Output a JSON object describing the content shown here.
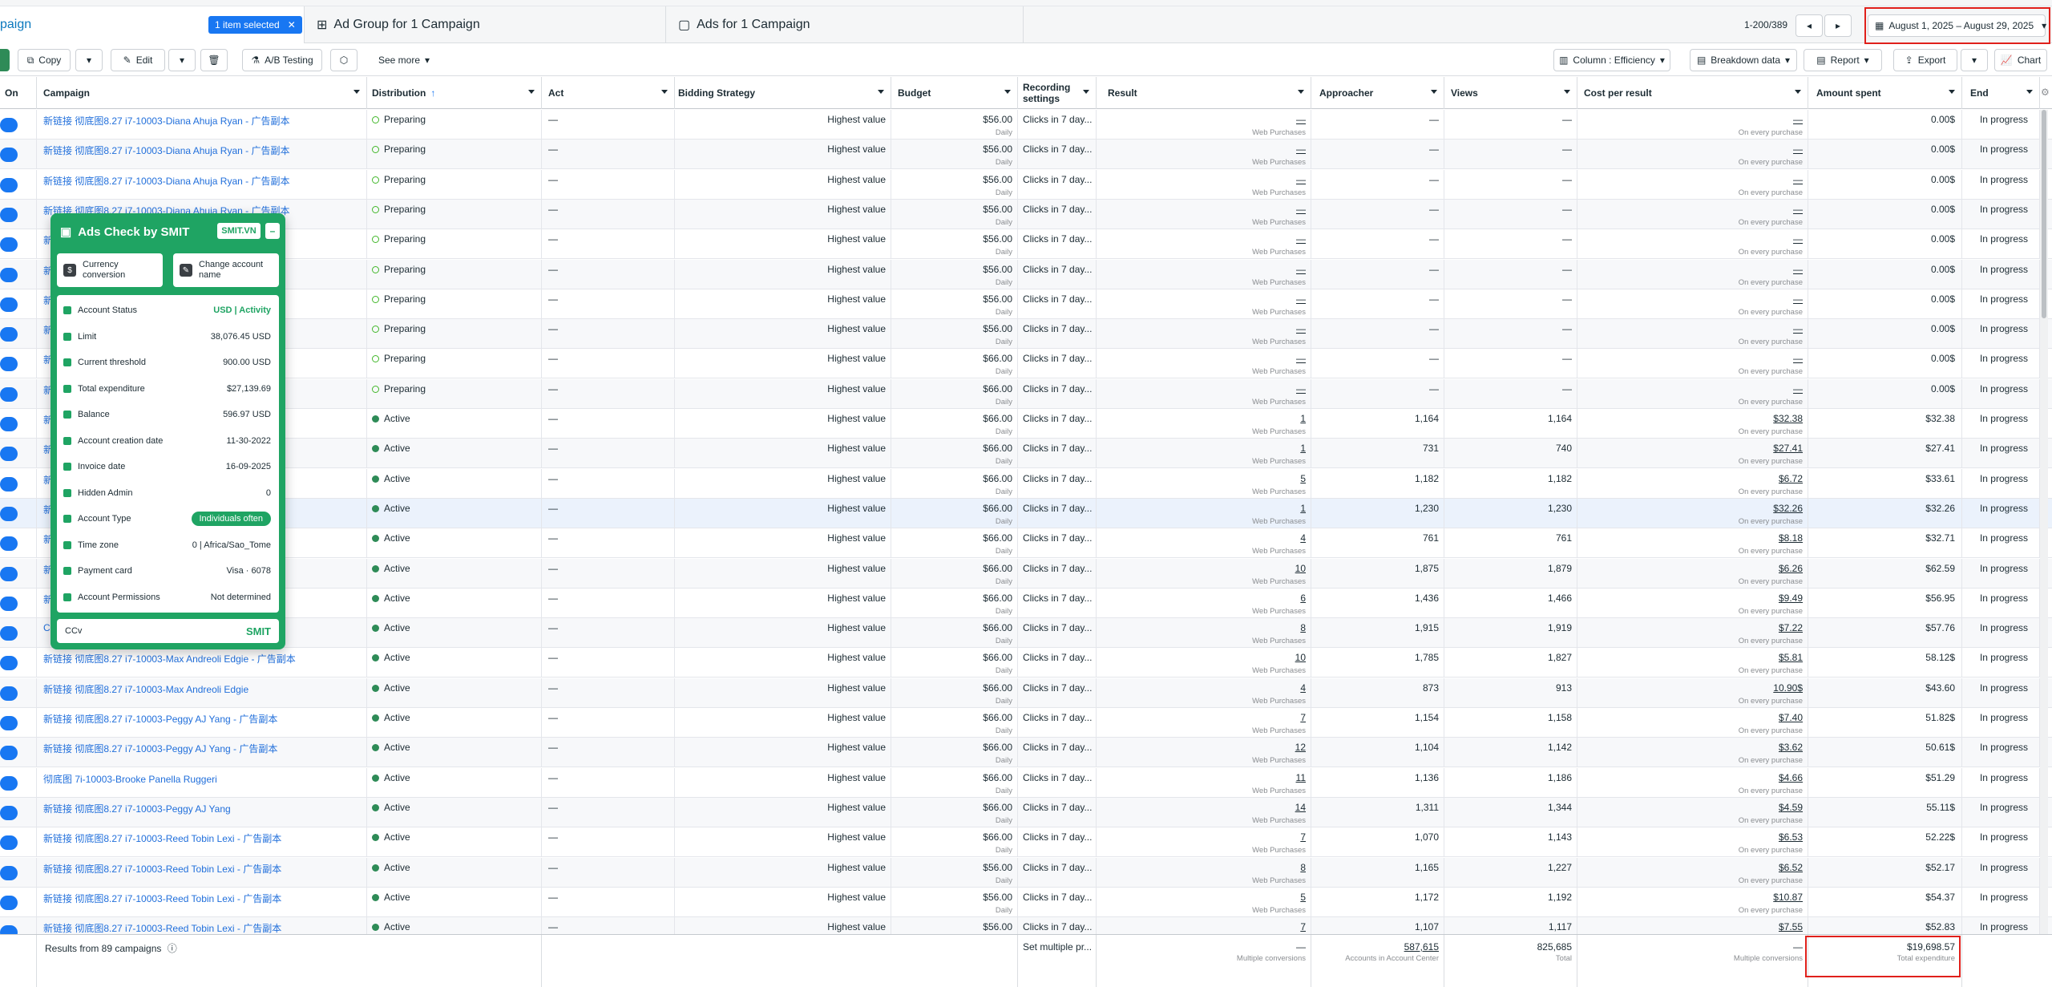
{
  "tabs": {
    "campaign_tab": "paign",
    "selected_badge": "1 item selected",
    "adgroup_tab": "Ad Group for 1 Campaign",
    "ads_tab": "Ads for 1 Campaign",
    "pagination": "1-200/389",
    "date_range": "August 1, 2025 – August 29, 2025"
  },
  "toolbar": {
    "copy": "Copy",
    "edit": "Edit",
    "ab_testing": "A/B Testing",
    "see_more": "See more",
    "column": "Column : Efficiency",
    "breakdown": "Breakdown data",
    "report": "Report",
    "export": "Export",
    "chart": "Chart"
  },
  "columns": {
    "on": "On",
    "campaign": "Campaign",
    "distribution": "Distribution",
    "act": "Act",
    "bidding": "Bidding Strategy",
    "budget": "Budget",
    "recording": "Recording settings",
    "result": "Result",
    "approacher": "Approacher",
    "views": "Views",
    "cost": "Cost per result",
    "amount": "Amount spent",
    "end": "End"
  },
  "rows": [
    {
      "campaign": "新链接 彻底图8.27 i7-10003-Diana Ahuja Ryan - 广告副本",
      "status": "Preparing",
      "active": false,
      "act": "—",
      "bidding": "Highest value",
      "budget": "$56.00",
      "budget_sub": "Daily",
      "recording": "Clicks in 7 day...",
      "result": "—",
      "result_sub": "Web Purchases",
      "approacher": "—",
      "views": "—",
      "cost": "—",
      "cost_sub": "On every purchase",
      "amount": "0.00$",
      "end": "In progress"
    },
    {
      "campaign": "新链接 彻底图8.27 i7-10003-Diana Ahuja Ryan - 广告副本",
      "status": "Preparing",
      "active": false,
      "act": "—",
      "bidding": "Highest value",
      "budget": "$56.00",
      "budget_sub": "Daily",
      "recording": "Clicks in 7 day...",
      "result": "—",
      "result_sub": "Web Purchases",
      "approacher": "—",
      "views": "—",
      "cost": "—",
      "cost_sub": "On every purchase",
      "amount": "0.00$",
      "end": "In progress"
    },
    {
      "campaign": "新链接 彻底图8.27 i7-10003-Diana Ahuja Ryan - 广告副本",
      "status": "Preparing",
      "active": false,
      "act": "—",
      "bidding": "Highest value",
      "budget": "$56.00",
      "budget_sub": "Daily",
      "recording": "Clicks in 7 day...",
      "result": "—",
      "result_sub": "Web Purchases",
      "approacher": "—",
      "views": "—",
      "cost": "—",
      "cost_sub": "On every purchase",
      "amount": "0.00$",
      "end": "In progress"
    },
    {
      "campaign": "新链接 彻底图8.27 i7-10003-Diana Ahuja Ryan - 广告副本",
      "status": "Preparing",
      "active": false,
      "act": "—",
      "bidding": "Highest value",
      "budget": "$56.00",
      "budget_sub": "Daily",
      "recording": "Clicks in 7 day...",
      "result": "—",
      "result_sub": "Web Purchases",
      "approacher": "—",
      "views": "—",
      "cost": "—",
      "cost_sub": "On every purchase",
      "amount": "0.00$",
      "end": "In progress"
    },
    {
      "campaign": "新链",
      "status": "Preparing",
      "active": false,
      "act": "—",
      "bidding": "Highest value",
      "budget": "$56.00",
      "budget_sub": "Daily",
      "recording": "Clicks in 7 day...",
      "result": "—",
      "result_sub": "Web Purchases",
      "approacher": "—",
      "views": "—",
      "cost": "—",
      "cost_sub": "On every purchase",
      "amount": "0.00$",
      "end": "In progress"
    },
    {
      "campaign": "新链",
      "status": "Preparing",
      "active": false,
      "act": "—",
      "bidding": "Highest value",
      "budget": "$56.00",
      "budget_sub": "Daily",
      "recording": "Clicks in 7 day...",
      "result": "—",
      "result_sub": "Web Purchases",
      "approacher": "—",
      "views": "—",
      "cost": "—",
      "cost_sub": "On every purchase",
      "amount": "0.00$",
      "end": "In progress"
    },
    {
      "campaign": "新链",
      "status": "Preparing",
      "active": false,
      "act": "—",
      "bidding": "Highest value",
      "budget": "$56.00",
      "budget_sub": "Daily",
      "recording": "Clicks in 7 day...",
      "result": "—",
      "result_sub": "Web Purchases",
      "approacher": "—",
      "views": "—",
      "cost": "—",
      "cost_sub": "On every purchase",
      "amount": "0.00$",
      "end": "In progress"
    },
    {
      "campaign": "新链",
      "status": "Preparing",
      "active": false,
      "act": "—",
      "bidding": "Highest value",
      "budget": "$56.00",
      "budget_sub": "Daily",
      "recording": "Clicks in 7 day...",
      "result": "—",
      "result_sub": "Web Purchases",
      "approacher": "—",
      "views": "—",
      "cost": "—",
      "cost_sub": "On every purchase",
      "amount": "0.00$",
      "end": "In progress"
    },
    {
      "campaign": "新链",
      "status": "Preparing",
      "active": false,
      "act": "—",
      "bidding": "Highest value",
      "budget": "$66.00",
      "budget_sub": "Daily",
      "recording": "Clicks in 7 day...",
      "result": "—",
      "result_sub": "Web Purchases",
      "approacher": "—",
      "views": "—",
      "cost": "—",
      "cost_sub": "On every purchase",
      "amount": "0.00$",
      "end": "In progress"
    },
    {
      "campaign": "新链",
      "status": "Preparing",
      "active": false,
      "act": "—",
      "bidding": "Highest value",
      "budget": "$66.00",
      "budget_sub": "Daily",
      "recording": "Clicks in 7 day...",
      "result": "—",
      "result_sub": "Web Purchases",
      "approacher": "—",
      "views": "—",
      "cost": "—",
      "cost_sub": "On every purchase",
      "amount": "0.00$",
      "end": "In progress"
    },
    {
      "campaign": "新链",
      "status": "Active",
      "active": true,
      "act": "—",
      "bidding": "Highest value",
      "budget": "$66.00",
      "budget_sub": "Daily",
      "recording": "Clicks in 7 day...",
      "result": "1",
      "result_sub": "Web Purchases",
      "approacher": "1,164",
      "views": "1,164",
      "cost": "$32.38",
      "cost_sub": "On every purchase",
      "amount": "$32.38",
      "end": "In progress"
    },
    {
      "campaign": "新链",
      "status": "Active",
      "active": true,
      "act": "—",
      "bidding": "Highest value",
      "budget": "$66.00",
      "budget_sub": "Daily",
      "recording": "Clicks in 7 day...",
      "result": "1",
      "result_sub": "Web Purchases",
      "approacher": "731",
      "views": "740",
      "cost": "$27.41",
      "cost_sub": "On every purchase",
      "amount": "$27.41",
      "end": "In progress"
    },
    {
      "campaign": "新链",
      "status": "Active",
      "active": true,
      "act": "—",
      "bidding": "Highest value",
      "budget": "$66.00",
      "budget_sub": "Daily",
      "recording": "Clicks in 7 day...",
      "result": "5",
      "result_sub": "Web Purchases",
      "approacher": "1,182",
      "views": "1,182",
      "cost": "$6.72",
      "cost_sub": "On every purchase",
      "amount": "$33.61",
      "end": "In progress"
    },
    {
      "campaign": "新链",
      "status": "Active",
      "active": true,
      "hl": true,
      "act": "—",
      "bidding": "Highest value",
      "budget": "$66.00",
      "budget_sub": "Daily",
      "recording": "Clicks in 7 day...",
      "result": "1",
      "result_sub": "Web Purchases",
      "approacher": "1,230",
      "views": "1,230",
      "cost": "$32.26",
      "cost_sub": "On every purchase",
      "amount": "$32.26",
      "end": "In progress"
    },
    {
      "campaign": "新链",
      "status": "Active",
      "active": true,
      "act": "—",
      "bidding": "Highest value",
      "budget": "$66.00",
      "budget_sub": "Daily",
      "recording": "Clicks in 7 day...",
      "result": "4",
      "result_sub": "Web Purchases",
      "approacher": "761",
      "views": "761",
      "cost": "$8.18",
      "cost_sub": "On every purchase",
      "amount": "$32.71",
      "end": "In progress"
    },
    {
      "campaign": "新链",
      "status": "Active",
      "active": true,
      "act": "—",
      "bidding": "Highest value",
      "budget": "$66.00",
      "budget_sub": "Daily",
      "recording": "Clicks in 7 day...",
      "result": "10",
      "result_sub": "Web Purchases",
      "approacher": "1,875",
      "views": "1,879",
      "cost": "$6.26",
      "cost_sub": "On every purchase",
      "amount": "$62.59",
      "end": "In progress"
    },
    {
      "campaign": "新链",
      "status": "Active",
      "active": true,
      "act": "—",
      "bidding": "Highest value",
      "budget": "$66.00",
      "budget_sub": "Daily",
      "recording": "Clicks in 7 day...",
      "result": "6",
      "result_sub": "Web Purchases",
      "approacher": "1,436",
      "views": "1,466",
      "cost": "$9.49",
      "cost_sub": "On every purchase",
      "amount": "$56.95",
      "end": "In progress"
    },
    {
      "campaign": "CC",
      "status": "Active",
      "active": true,
      "act": "—",
      "bidding": "Highest value",
      "budget": "$66.00",
      "budget_sub": "Daily",
      "recording": "Clicks in 7 day...",
      "result": "8",
      "result_sub": "Web Purchases",
      "approacher": "1,915",
      "views": "1,919",
      "cost": "$7.22",
      "cost_sub": "On every purchase",
      "amount": "$57.76",
      "end": "In progress"
    },
    {
      "campaign": "新链接 彻底图8.27 i7-10003-Max Andreoli Edgie - 广告副本",
      "status": "Active",
      "active": true,
      "act": "—",
      "bidding": "Highest value",
      "budget": "$66.00",
      "budget_sub": "Daily",
      "recording": "Clicks in 7 day...",
      "result": "10",
      "result_sub": "Web Purchases",
      "approacher": "1,785",
      "views": "1,827",
      "cost": "$5.81",
      "cost_sub": "On every purchase",
      "amount": "58.12$",
      "end": "In progress"
    },
    {
      "campaign": "新链接 彻底图8.27 i7-10003-Max Andreoli Edgie",
      "status": "Active",
      "active": true,
      "act": "—",
      "bidding": "Highest value",
      "budget": "$66.00",
      "budget_sub": "Daily",
      "recording": "Clicks in 7 day...",
      "result": "4",
      "result_sub": "Web Purchases",
      "approacher": "873",
      "views": "913",
      "cost": "10.90$",
      "cost_sub": "On every purchase",
      "amount": "$43.60",
      "end": "In progress"
    },
    {
      "campaign": "新链接 彻底图8.27 i7-10003-Peggy AJ Yang - 广告副本",
      "status": "Active",
      "active": true,
      "act": "—",
      "bidding": "Highest value",
      "budget": "$66.00",
      "budget_sub": "Daily",
      "recording": "Clicks in 7 day...",
      "result": "7",
      "result_sub": "Web Purchases",
      "approacher": "1,154",
      "views": "1,158",
      "cost": "$7.40",
      "cost_sub": "On every purchase",
      "amount": "51.82$",
      "end": "In progress"
    },
    {
      "campaign": "新链接 彻底图8.27 i7-10003-Peggy AJ Yang - 广告副本",
      "status": "Active",
      "active": true,
      "act": "—",
      "bidding": "Highest value",
      "budget": "$66.00",
      "budget_sub": "Daily",
      "recording": "Clicks in 7 day...",
      "result": "12",
      "result_sub": "Web Purchases",
      "approacher": "1,104",
      "views": "1,142",
      "cost": "$3.62",
      "cost_sub": "On every purchase",
      "amount": "50.61$",
      "end": "In progress"
    },
    {
      "campaign": "彻底图 7i-10003-Brooke Panella Ruggeri",
      "status": "Active",
      "active": true,
      "act": "—",
      "bidding": "Highest value",
      "budget": "$66.00",
      "budget_sub": "Daily",
      "recording": "Clicks in 7 day...",
      "result": "11",
      "result_sub": "Web Purchases",
      "approacher": "1,136",
      "views": "1,186",
      "cost": "$4.66",
      "cost_sub": "On every purchase",
      "amount": "$51.29",
      "end": "In progress"
    },
    {
      "campaign": "新链接 彻底图8.27 i7-10003-Peggy AJ Yang",
      "status": "Active",
      "active": true,
      "act": "—",
      "bidding": "Highest value",
      "budget": "$66.00",
      "budget_sub": "Daily",
      "recording": "Clicks in 7 day...",
      "result": "14",
      "result_sub": "Web Purchases",
      "approacher": "1,311",
      "views": "1,344",
      "cost": "$4.59",
      "cost_sub": "On every purchase",
      "amount": "55.11$",
      "end": "In progress"
    },
    {
      "campaign": "新链接 彻底图8.27 i7-10003-Reed Tobin Lexi - 广告副本",
      "status": "Active",
      "active": true,
      "act": "—",
      "bidding": "Highest value",
      "budget": "$66.00",
      "budget_sub": "Daily",
      "recording": "Clicks in 7 day...",
      "result": "7",
      "result_sub": "Web Purchases",
      "approacher": "1,070",
      "views": "1,143",
      "cost": "$6.53",
      "cost_sub": "On every purchase",
      "amount": "52.22$",
      "end": "In progress"
    },
    {
      "campaign": "新链接 彻底图8.27 i7-10003-Reed Tobin Lexi - 广告副本",
      "status": "Active",
      "active": true,
      "act": "—",
      "bidding": "Highest value",
      "budget": "$56.00",
      "budget_sub": "Daily",
      "recording": "Clicks in 7 day...",
      "result": "8",
      "result_sub": "Web Purchases",
      "approacher": "1,165",
      "views": "1,227",
      "cost": "$6.52",
      "cost_sub": "On every purchase",
      "amount": "$52.17",
      "end": "In progress"
    },
    {
      "campaign": "新链接 彻底图8.27 i7-10003-Reed Tobin Lexi - 广告副本",
      "status": "Active",
      "active": true,
      "act": "—",
      "bidding": "Highest value",
      "budget": "$56.00",
      "budget_sub": "Daily",
      "recording": "Clicks in 7 day...",
      "result": "5",
      "result_sub": "Web Purchases",
      "approacher": "1,172",
      "views": "1,192",
      "cost": "$10.87",
      "cost_sub": "On every purchase",
      "amount": "$54.37",
      "end": "In progress"
    },
    {
      "campaign": "新链接 彻底图8.27 i7-10003-Reed Tobin Lexi - 广告副本",
      "status": "Active",
      "active": true,
      "act": "—",
      "bidding": "Highest value",
      "budget": "$56.00",
      "budget_sub": "Daily",
      "recording": "Clicks in 7 day...",
      "result": "7",
      "result_sub": "Web Purchases",
      "approacher": "1,107",
      "views": "1,117",
      "cost": "$7.55",
      "cost_sub": "On every purchase",
      "amount": "$52.83",
      "end": "In progress"
    }
  ],
  "footer": {
    "results": "Results from 89 campaigns",
    "recording": "Set multiple pr...",
    "result": "—",
    "result_sub": "Multiple conversions",
    "approacher": "587,615",
    "approacher_sub": "Accounts in Account Center",
    "views": "825,685",
    "views_sub": "Total",
    "cost": "—",
    "cost_sub": "Multiple conversions",
    "amount": "$19,698.57",
    "amount_sub": "Total expenditure"
  },
  "overlay": {
    "title": "Ads Check by SMIT",
    "tag": "SMIT.VN",
    "minimize": "–",
    "btn_currency": "Currency conversion",
    "btn_rename": "Change account name",
    "items": [
      {
        "label": "Account Status",
        "value": "USD | Activity"
      },
      {
        "label": "Limit",
        "value": "38,076.45 USD"
      },
      {
        "label": "Current threshold",
        "value": "900.00 USD"
      },
      {
        "label": "Total expenditure",
        "value": "$27,139.69"
      },
      {
        "label": "Balance",
        "value": "596.97 USD"
      },
      {
        "label": "Account creation date",
        "value": "11-30-2022"
      },
      {
        "label": "Invoice date",
        "value": "16-09-2025"
      },
      {
        "label": "Hidden Admin",
        "value": "0"
      },
      {
        "label": "Account Type",
        "value": "Individuals often"
      },
      {
        "label": "Time zone",
        "value": "0 | Africa/Sao_Tome"
      },
      {
        "label": "Payment card",
        "value": "Visa · 6078"
      },
      {
        "label": "Account Permissions",
        "value": "Not determined"
      }
    ],
    "foot_left": "CCv",
    "foot_logo": "SMIT"
  },
  "colors": {
    "accent": "#1877f2",
    "link": "#216fdb",
    "smit_green": "#1fa463",
    "highlight_red": "#e0201b"
  }
}
